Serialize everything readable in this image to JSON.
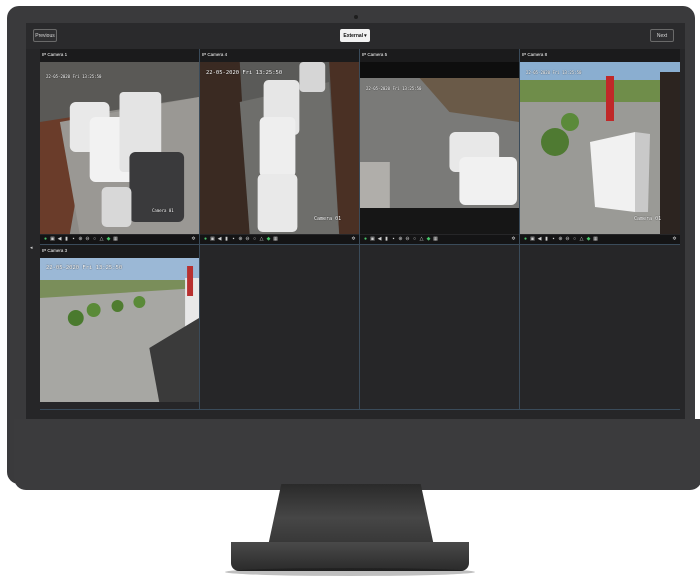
{
  "toolbar": {
    "previous_label": "Previous",
    "view_select_value": "External",
    "next_label": "Next"
  },
  "cameras": [
    {
      "title": "IP Camera 1",
      "osd_time": "22-05-2020 Fri 13:25:50",
      "osd_label": "Camera 01"
    },
    {
      "title": "IP Camera 4",
      "osd_time": "22-05-2020 Fri 13:25:50",
      "osd_label": "Camera 01"
    },
    {
      "title": "IP Camera 5",
      "osd_time": "22-05-2020 Fri 13:25:50",
      "osd_label": ""
    },
    {
      "title": "IP Camera 8",
      "osd_time": "22-05-2020 Fri 13:25:50",
      "osd_label": "Camera 01"
    },
    {
      "title": "IP Camera 3",
      "osd_time": "22-05-2020 Fri 13:25:50",
      "osd_label": ""
    }
  ],
  "controls": [
    "record-icon",
    "snapshot-icon",
    "play-icon",
    "audio-icon",
    "lock-icon",
    "zoom-in-icon",
    "zoom-out-icon",
    "ptz-icon",
    "light-icon",
    "color-icon",
    "info-icon",
    "settings-icon"
  ],
  "colors": {
    "bezel": "#3a3a3c",
    "screen": "#262628",
    "accent_green": "#49c46a",
    "grid_line": "#3a4b5a"
  }
}
